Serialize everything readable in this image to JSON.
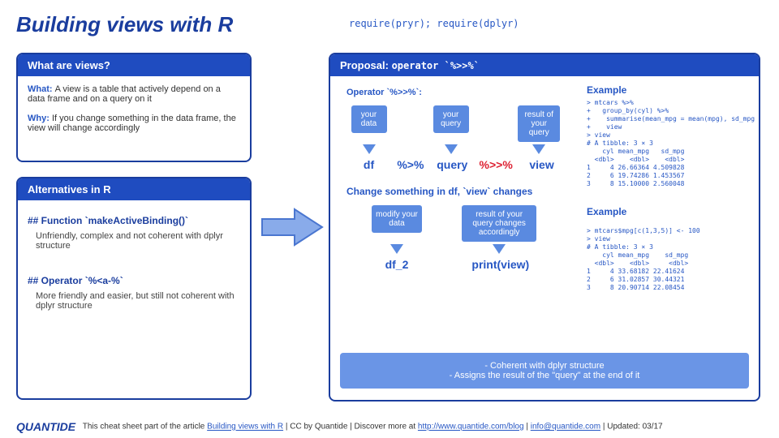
{
  "title": "Building views with R",
  "header_code": "require(pryr); require(dplyr)",
  "p1": {
    "h": "What are views?",
    "what_l": "What: ",
    "what_t": "A view is a table that actively depend on a data frame and on a query on it",
    "why_l": "Why: ",
    "why_t": "If you change something in the data frame, the view will change accordingly"
  },
  "p2": {
    "h": "Alternatives in R",
    "a1h": "## Function `makeActiveBinding()`",
    "a1b": "Unfriendly, complex and not coherent with dplyr structure",
    "a2h": "## Operator `%<a-%`",
    "a2b": "More friendly and easier, but still not coherent with dplyr structure"
  },
  "p3": {
    "h": "Proposal: ",
    "hop": "operator `%>>%`",
    "op": "Operator `%>>%`:",
    "b1": "your data",
    "b2": "your query",
    "b3": "result of your query",
    "l1": "df",
    "l2": "%>%",
    "l3": "query",
    "l4": "%>>%",
    "l5": "view",
    "chg": "Change something in df, `view` changes",
    "b4": "modify your data",
    "b5": "result of your query changes accordingly",
    "l6": "df_2",
    "l7": "print(view)",
    "f1": "-      Coherent with dplyr structure",
    "f2": "-      Assigns the result of the \"query\" at the end of it"
  },
  "ex": {
    "h": "Example",
    "c1": "> mtcars %>%\n+   group_by(cyl) %>%\n+    summarise(mean_mpg = mean(mpg), sd_mpg = sd(mpg)) %>>%\n+    view\n> view\n# A tibble: 3 × 3\n    cyl mean_mpg   sd_mpg\n  <dbl>    <dbl>    <dbl>\n1     4 26.66364 4.509828\n2     6 19.74286 1.453567\n3     8 15.10000 2.560048",
    "c2": "> mtcars$mpg[c(1,3,5)] <- 100\n> view\n# A tibble: 3 × 3\n    cyl mean_mpg    sd_mpg\n  <dbl>    <dbl>     <dbl>\n1     4 33.68182 22.41624\n2     6 31.02857 30.44321\n3     8 20.90714 22.08454"
  },
  "ftr": {
    "logo": "QUANTIDE",
    "t1": "This cheat sheet part of the article ",
    "lk1": "Building views with R",
    "t2": "  | CC by Quantide | Discover more at ",
    "lk2": "http://www.quantide.com/blog",
    "t3": " | ",
    "lk3": "info@quantide.com",
    "t4": " | Updated: 03/17"
  }
}
